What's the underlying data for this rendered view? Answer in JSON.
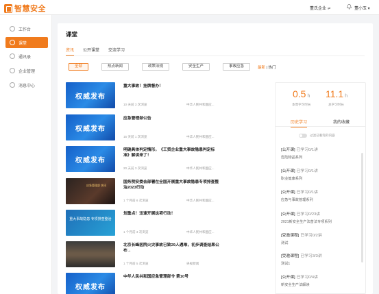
{
  "header": {
    "logo_text": "智慧安全",
    "company": "董氏企业",
    "user": "董小玉"
  },
  "sidebar": {
    "items": [
      {
        "label": "工作台",
        "icon": "dashboard-icon"
      },
      {
        "label": "课堂",
        "icon": "classroom-icon",
        "active": true
      },
      {
        "label": "通讯录",
        "icon": "contacts-icon"
      },
      {
        "label": "企业管理",
        "icon": "enterprise-icon"
      },
      {
        "label": "消息中心",
        "icon": "message-icon"
      }
    ]
  },
  "main": {
    "title": "课堂",
    "tabs": [
      "资讯",
      "公开课堂",
      "交流学习"
    ],
    "filters": [
      "全部",
      "热点新闻",
      "政策法规",
      "安全生产",
      "事故应急"
    ],
    "sort": {
      "latest": "最新",
      "sep": "|",
      "hot": "热门"
    }
  },
  "articles": [
    {
      "thumb": "权威发布",
      "style": "blue",
      "title": "重大事故！挂牌督办！",
      "meta": "10 天前  3 次浏览",
      "source": "中华人民共和国应..."
    },
    {
      "thumb": "权威发布",
      "style": "blue",
      "title": "应急管理部公告",
      "meta": "15 天前  1 次浏览",
      "source": "中华人民共和国应..."
    },
    {
      "thumb": "权威发布",
      "style": "blue",
      "title": "明确具体判定情形，《工贸企业重大事故隐患判定标准》解读来了！",
      "meta": "20 天前  3 次浏览",
      "source": "中华人民共和国应..."
    },
    {
      "thumb": "应急管理部 快讯",
      "style": "dark",
      "title": "国务院安委会部署在全国开展重大事故隐患专项排查整治2023行动",
      "meta": "1 个月前  6 次浏览",
      "source": "中华人民共和国应..."
    },
    {
      "thumb": "重大事故隐患 专项排查整治",
      "style": "teal",
      "title": "划重点！迅速开展这项行动！",
      "meta": "1 个月前  3 次浏览",
      "source": "中华人民共和国应..."
    },
    {
      "thumb": "",
      "style": "photo",
      "title": "北京长峰医院火灾事故已致29人遇难，初步调查结果公布→",
      "meta": "1 个月前  5 次浏览",
      "source": "央视新闻"
    },
    {
      "thumb": "权威发布",
      "style": "blue",
      "title": "中华人民共和国应急管理部令 第10号",
      "meta": "",
      "source": ""
    }
  ],
  "stats": {
    "week_value": "0.5",
    "week_unit": "h",
    "week_label": "本周学习时长",
    "total_value": "11.1",
    "total_unit": "h",
    "total_label": "总学习时长"
  },
  "panel": {
    "tabs": [
      "历史学习",
      "我的收藏"
    ],
    "toggle_label": "过滤已看完的内容",
    "courses": [
      {
        "tag": "[公开课]",
        "progress": "已学习0/1讲",
        "name": "危险物品系列"
      },
      {
        "tag": "[公开课]",
        "progress": "已学习0/1讲",
        "name": "职业健康系列"
      },
      {
        "tag": "[公开课]",
        "progress": "已学习0/1讲",
        "name": "应急与事故管理系列"
      },
      {
        "tag": "[公开课]",
        "progress": "已学习0/23讲",
        "name": "2021新安全生产法普法专项系列"
      },
      {
        "tag": "[受邀课程]",
        "progress": "已学习0/2讲",
        "name": "测试"
      },
      {
        "tag": "[受邀课程]",
        "progress": "已学习3/3讲",
        "name": "测试1"
      },
      {
        "tag": "[公开课]",
        "progress": "已学习0/4讲",
        "name": "新安全生产法解读"
      }
    ]
  },
  "colors": {
    "accent": "#f07b1d"
  }
}
